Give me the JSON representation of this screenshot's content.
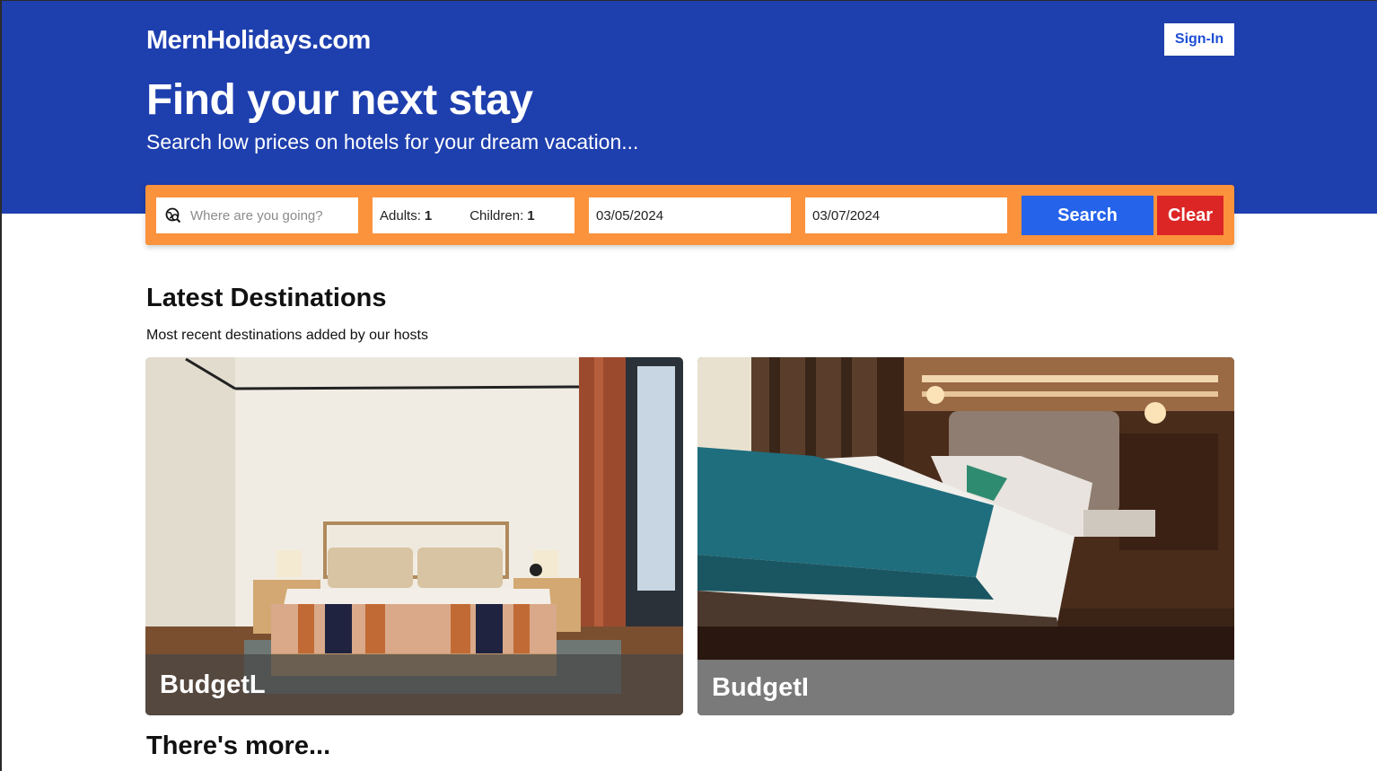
{
  "header": {
    "logo": "MernHolidays.com",
    "sign_in_label": "Sign-In"
  },
  "hero": {
    "title": "Find your next stay",
    "subtitle": "Search low prices on hotels for your dream vacation..."
  },
  "search": {
    "destination_placeholder": "Where are you going?",
    "destination_value": "",
    "adults_label": "Adults:",
    "adults_value": "1",
    "children_label": "Children:",
    "children_value": "1",
    "check_in": "03/05/2024",
    "check_out": "03/07/2024",
    "search_label": "Search",
    "clear_label": "Clear"
  },
  "latest": {
    "title": "Latest Destinations",
    "subtitle": "Most recent destinations added by our hosts",
    "cards": [
      {
        "name": "BudgetL"
      },
      {
        "name": "BudgetI"
      }
    ]
  },
  "more": {
    "title": "There's more..."
  },
  "colors": {
    "header_bg": "#1e3fae",
    "search_bar": "#fb923c",
    "search_button": "#2563eb",
    "clear_button": "#dc2626"
  },
  "icons": {
    "destination": "globe-search-icon"
  }
}
